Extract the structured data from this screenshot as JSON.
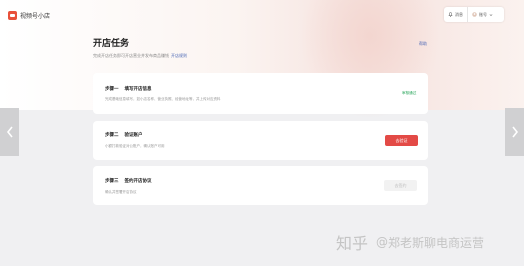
{
  "app": {
    "name": "视频号小店"
  },
  "header": {
    "messages_label": "消息",
    "account_label": "账号"
  },
  "page": {
    "title": "开店任务",
    "subtitle": "完成开店任务即可开店营业并发布商品赚钱",
    "subtitle_link": "开店规则",
    "help_link": "帮助"
  },
  "steps": [
    {
      "step": "步骤一",
      "title": "填写开店信息",
      "desc": "完成基础信息填写，如小店名称、营业执照、经营地址等，并上传对应资料",
      "status": "审核通过"
    },
    {
      "step": "步骤二",
      "title": "验证账户",
      "desc": "小额打款验证对公账户，确认账户可用",
      "button": "去验证"
    },
    {
      "step": "步骤三",
      "title": "签约开店协议",
      "desc": "确认并签署开店协议",
      "button": "去签约"
    }
  ],
  "watermark": {
    "brand": "知乎",
    "at": "@",
    "user": "郑老斯聊电商运营"
  }
}
